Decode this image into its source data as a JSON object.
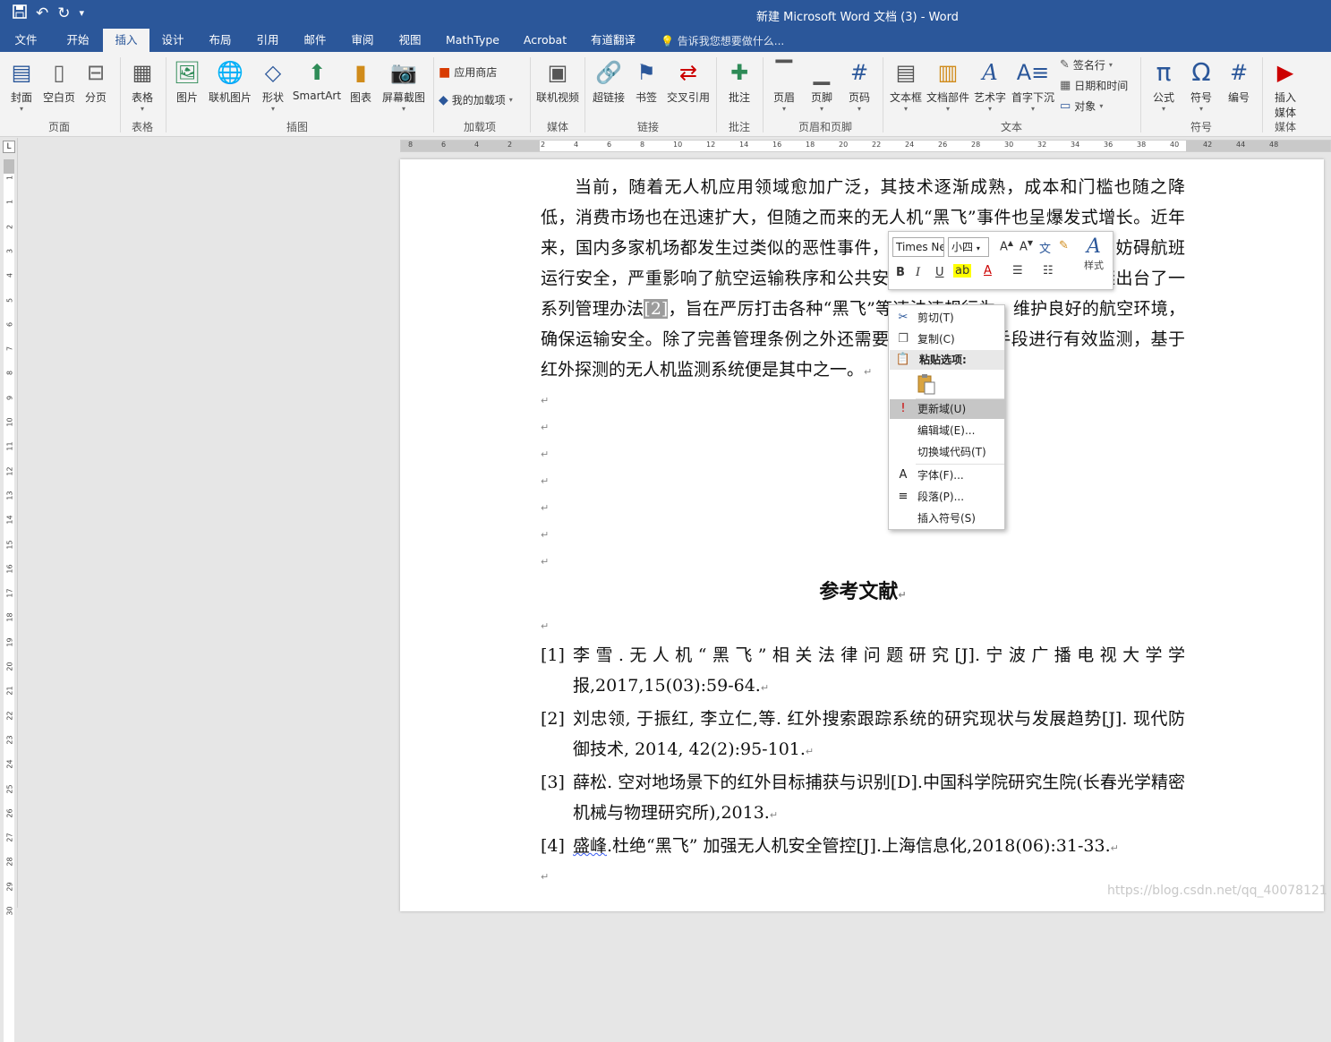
{
  "window": {
    "title": "新建 Microsoft Word 文档 (3) - Word"
  },
  "qat": {
    "save_icon": "floppy",
    "undo_icon": "↶",
    "redo_icon": "↻",
    "customize_icon": "▾"
  },
  "tabs": [
    "文件",
    "开始",
    "插入",
    "设计",
    "布局",
    "引用",
    "邮件",
    "审阅",
    "视图",
    "MathType",
    "Acrobat",
    "有道翻译"
  ],
  "active_tab": "插入",
  "tell_me": "告诉我您想要做什么...",
  "ribbon": {
    "groups": {
      "pages": "页面",
      "tables": "表格",
      "illustrations": "插图",
      "addins": "加载项",
      "media": "媒体",
      "links": "链接",
      "comments": "批注",
      "header_footer": "页眉和页脚",
      "text": "文本",
      "symbols": "符号",
      "media2": "媒体"
    },
    "buttons": {
      "cover": "封面",
      "blank_page": "空白页",
      "page_break": "分页",
      "table": "表格",
      "picture": "图片",
      "online_picture": "联机图片",
      "shapes": "形状",
      "smartart": "SmartArt",
      "chart": "图表",
      "screenshot": "屏幕截图",
      "store": "应用商店",
      "my_addins": "我的加载项",
      "online_video": "联机视频",
      "hyperlink": "超链接",
      "bookmark": "书签",
      "cross_ref": "交叉引用",
      "comment": "批注",
      "header": "页眉",
      "footer": "页脚",
      "page_number": "页码",
      "textbox": "文本框",
      "quick_parts": "文档部件",
      "wordart": "艺术字",
      "dropcap": "首字下沉",
      "signature": "签名行",
      "datetime": "日期和时间",
      "object": "对象",
      "equation": "公式",
      "symbol": "符号",
      "number": "编号",
      "insert_media_1": "插入",
      "insert_media_2": "媒体"
    }
  },
  "doc": {
    "para_before": "当前，随着无人机应用领域愈加广泛，其技术逐渐成熟，成本和门槛也随之降低，消费市场也在迅速扩大，但随之而来的无人机“黑飞”事件也呈爆发式增长。近年来，国内多家机场都发生过类似的恶性",
    "para_hidden1": "事件，无人机飞入机",
    "para_mid1": "场净空保护区，妨碍航班运行安全，严重影响了航空",
    "para_hidden2": "运输秩序和公共安全",
    "para_mid2": "。为此，国家和地方也相继出台了一系列管理办法",
    "para_sel": "[2]",
    "para_hidden3": "，旨在",
    "para_mid3": "严厉打击各种“黑飞”等违法违规行为，维护良好的航空环境，确保运输安",
    "para_hidden4": "全。除了完善",
    "para_mid4": "管理条例之外还需要采取一些监测手段进行有效监测，基于红外探",
    "para_hidden5": "测的无人机监测系",
    "para_end": "统便是其中之一。",
    "para_mark": "↵",
    "heading": "参考文献",
    "refs": [
      {
        "num": "[1]",
        "text": "李雪.无人机“黑飞”相关法律问题研究[J].宁波广播电视大学学报,2017,15(03):59-64."
      },
      {
        "num": "[2]",
        "text": "刘忠领, 于振红, 李立仁,等. 红外搜索跟踪系统的研究现状与发展趋势[J]. 现代防御技术, 2014, 42(2):95-101."
      },
      {
        "num": "[3]",
        "text": "薛松. 空对地场景下的红外目标捕获与识别[D].中国科学院研究生院(长春光学精密机械与物理研究所),2013."
      },
      {
        "num": "[4]",
        "squig": "盛峰",
        "text": ".杜绝“黑飞” 加强无人机安全管控[J].上海信息化,2018(06):31-33."
      }
    ]
  },
  "mini_toolbar": {
    "font": "Times New Roman",
    "size": "小四",
    "bold": "B",
    "italic": "I",
    "underline": "U",
    "styles": "样式"
  },
  "context_menu": {
    "cut": "剪切(T)",
    "copy": "复制(C)",
    "paste_options": "粘贴选项:",
    "update_field": "更新域(U)",
    "edit_field": "编辑域(E)...",
    "toggle_codes": "切换域代码(T)",
    "font": "字体(F)...",
    "paragraph": "段落(P)...",
    "insert_symbol": "插入符号(S)"
  },
  "watermark": "https://blog.csdn.net/qq_40078121",
  "ruler_top": [
    "8",
    "6",
    "4",
    "2",
    "2",
    "4",
    "6",
    "8",
    "10",
    "12",
    "14",
    "16",
    "18",
    "20",
    "22",
    "24",
    "26",
    "28",
    "30",
    "32",
    "34",
    "36",
    "38",
    "40",
    "42",
    "44",
    "48"
  ],
  "ruler_left": [
    "1",
    "1",
    "2",
    "3",
    "4",
    "5",
    "6",
    "7",
    "8",
    "9",
    "10",
    "11",
    "12",
    "13",
    "14",
    "15",
    "16",
    "17",
    "18",
    "19",
    "20",
    "21",
    "22",
    "23",
    "24",
    "25",
    "26",
    "27",
    "28",
    "29",
    "30"
  ],
  "colors": {
    "word_blue": "#2b579a",
    "ribbon_bg": "#f3f3f3",
    "selection": "#9c9c9c"
  }
}
